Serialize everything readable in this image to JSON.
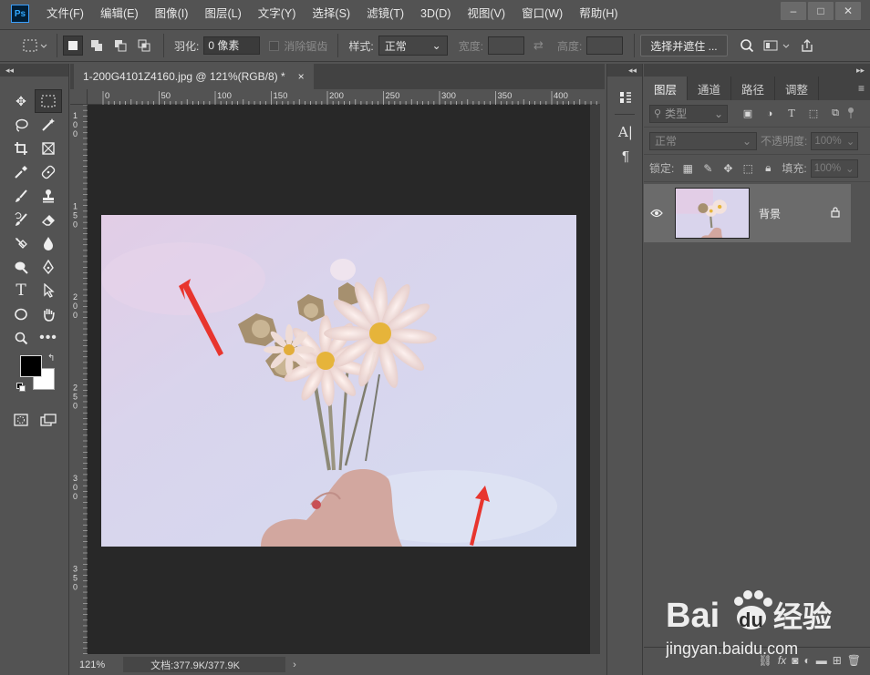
{
  "app": {
    "logo_text": "Ps",
    "accent": "#31a8ff"
  },
  "menu": [
    "文件(F)",
    "编辑(E)",
    "图像(I)",
    "图层(L)",
    "文字(Y)",
    "选择(S)",
    "滤镜(T)",
    "3D(D)",
    "视图(V)",
    "窗口(W)",
    "帮助(H)"
  ],
  "window_controls": [
    "minimize-icon",
    "maximize-icon",
    "close-icon"
  ],
  "options": {
    "feather_label": "羽化:",
    "feather_value": "0 像素",
    "antialias_label": "消除锯齿",
    "style_label": "样式:",
    "style_value": "正常",
    "width_label": "宽度:",
    "height_label": "高度:",
    "select_mask_button": "选择并遮住 ..."
  },
  "document": {
    "tab_title": "1-200G4101Z4160.jpg @ 121%(RGB/8) *",
    "close_glyph": "×",
    "ruler_top_labels": [
      "0",
      "50",
      "100",
      "150",
      "200",
      "250",
      "300",
      "350",
      "400"
    ],
    "ruler_left_labels": [
      "1 0 0",
      "1 5 0",
      "2 0 0",
      "2 5 0",
      "3 0 0",
      "3 5 0"
    ],
    "zoom": "121%",
    "doc_size": "文档:377.9K/377.9K",
    "status_arrow": "›"
  },
  "layers_panel": {
    "tabs": [
      "图层",
      "通道",
      "路径",
      "调整"
    ],
    "active_tab": "图层",
    "filter_placeholder": "类型",
    "blend_mode": "正常",
    "opacity_label": "不透明度:",
    "opacity_value": "100%",
    "lock_label": "锁定:",
    "fill_label": "填充:",
    "fill_value": "100%",
    "layers": [
      {
        "name": "背景",
        "visible": true,
        "locked": true
      }
    ]
  },
  "watermark": {
    "brand": "Bai du 经验",
    "url": "jingyan.baidu.com"
  },
  "colors": {
    "ui_bg": "#535353",
    "canvas_bg": "#282828",
    "annotation_arrow": "#e8352e"
  }
}
